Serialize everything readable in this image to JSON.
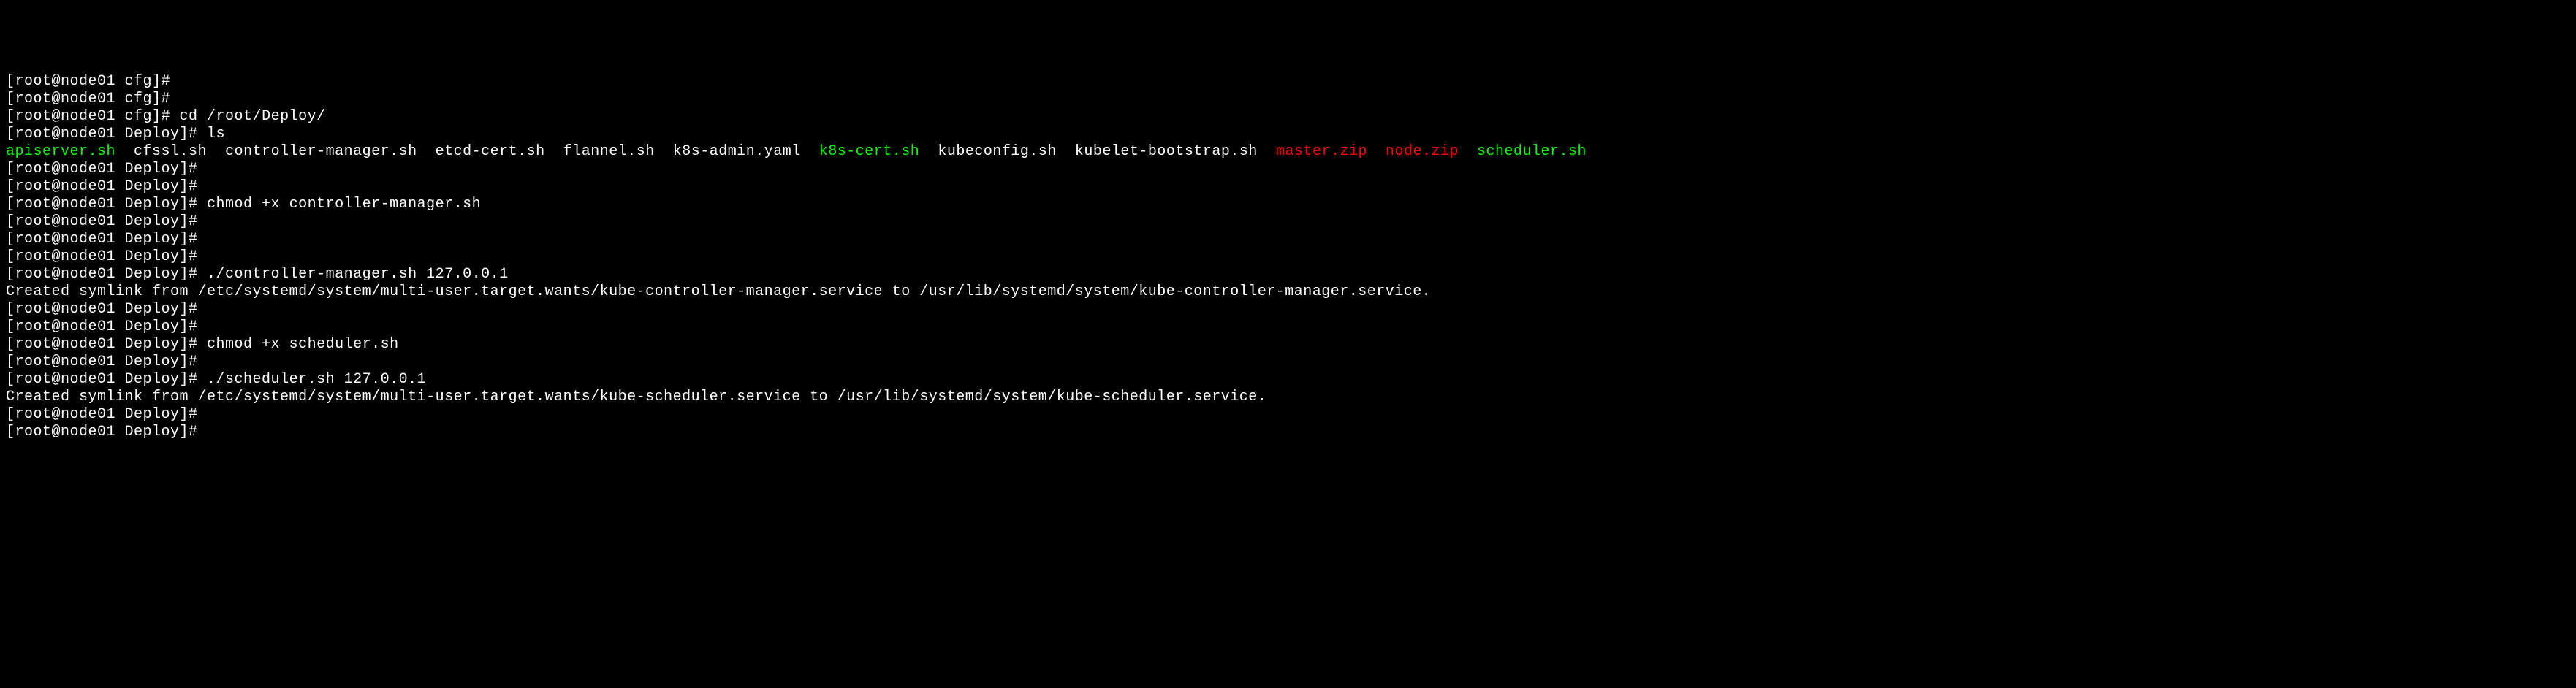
{
  "prompts": {
    "cfg": "[root@node01 cfg]# ",
    "deploy": "[root@node01 Deploy]# "
  },
  "commands": {
    "cd": "cd /root/Deploy/",
    "ls": "ls",
    "chmod_controller": "chmod +x controller-manager.sh",
    "run_controller": "./controller-manager.sh 127.0.0.1",
    "chmod_scheduler": "chmod +x scheduler.sh",
    "run_scheduler": "./scheduler.sh 127.0.0.1"
  },
  "files": {
    "apiserver": "apiserver.sh",
    "cfssl": "cfssl.sh",
    "controller_manager": "controller-manager.sh",
    "etcd_cert": "etcd-cert.sh",
    "flannel": "flannel.sh",
    "k8s_admin": "k8s-admin.yaml",
    "k8s_cert": "k8s-cert.sh",
    "kubeconfig": "kubeconfig.sh",
    "kubelet_bootstrap": "kubelet-bootstrap.sh",
    "master_zip": "master.zip",
    "node_zip": "node.zip",
    "scheduler": "scheduler.sh"
  },
  "output": {
    "symlink_controller": "Created symlink from /etc/systemd/system/multi-user.target.wants/kube-controller-manager.service to /usr/lib/systemd/system/kube-controller-manager.service.",
    "symlink_scheduler": "Created symlink from /etc/systemd/system/multi-user.target.wants/kube-scheduler.service to /usr/lib/systemd/system/kube-scheduler.service."
  },
  "sep": {
    "s2": "  ",
    "s3": "   "
  }
}
